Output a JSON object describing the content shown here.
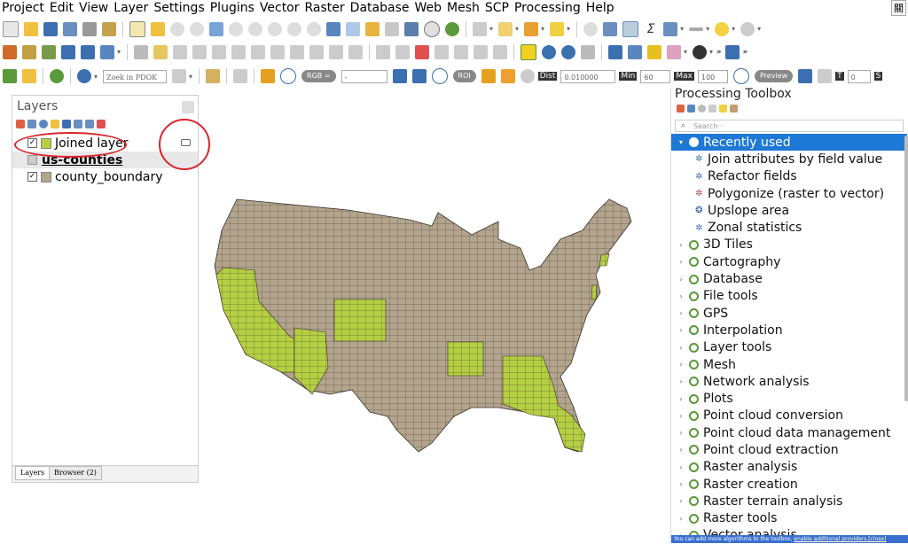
{
  "menu": [
    "Project",
    "Edit",
    "View",
    "Layer",
    "Settings",
    "Plugins",
    "Vector",
    "Raster",
    "Database",
    "Web",
    "Mesh",
    "SCP",
    "Processing",
    "Help"
  ],
  "menu_right": "關",
  "toolbar3": {
    "locator_placeholder": "Zoek in PDOK Loc···",
    "rgb_label": "RGB =",
    "rgb_value": "-",
    "roi_label": "ROI",
    "dist_label": "Dist",
    "dist_value": "0.010000",
    "min_label": "Min",
    "min_value": "60",
    "max_label": "Max",
    "max_value": "100",
    "preview_label": "Preview",
    "t_label": "T",
    "t_value": "0",
    "s_label": "S"
  },
  "layers_panel": {
    "title": "Layers",
    "items": [
      {
        "label": "Joined layer",
        "checked": "✓",
        "color": "#b5cf43"
      },
      {
        "label": "us-counties"
      },
      {
        "label": "county_boundary",
        "checked": "✓",
        "color": "#b3a48e"
      }
    ],
    "tabs": [
      "Layers",
      "Browser (2)"
    ]
  },
  "toolbox": {
    "title": "Processing Toolbox",
    "search_placeholder": "Search···",
    "recent": {
      "label": "Recently used",
      "expanded": "▾"
    },
    "recent_items": [
      {
        "label": "Join attributes by field value",
        "icon": "gear-icon"
      },
      {
        "label": "Refactor fields",
        "icon": "gear-icon"
      },
      {
        "label": "Polygonize (raster to vector)",
        "icon": "gdal-icon"
      },
      {
        "label": "Upslope area",
        "icon": "saga-icon"
      },
      {
        "label": "Zonal statistics",
        "icon": "gear-icon"
      }
    ],
    "groups": [
      "3D Tiles",
      "Cartography",
      "Database",
      "File tools",
      "GPS",
      "Interpolation",
      "Layer tools",
      "Mesh",
      "Network analysis",
      "Plots",
      "Point cloud conversion",
      "Point cloud data management",
      "Point cloud extraction",
      "Raster analysis",
      "Raster creation",
      "Raster terrain analysis",
      "Raster tools",
      "Vector analysis"
    ],
    "collapsed_arrow": "›",
    "status_text": "You can add more algorithms to the toolbox,",
    "status_link": "enable additional providers.[close]"
  },
  "colors": {
    "joined": "#b5cf43",
    "boundary": "#b3a48e",
    "annotation": "#d9262c",
    "selection": "#1e78d6"
  }
}
